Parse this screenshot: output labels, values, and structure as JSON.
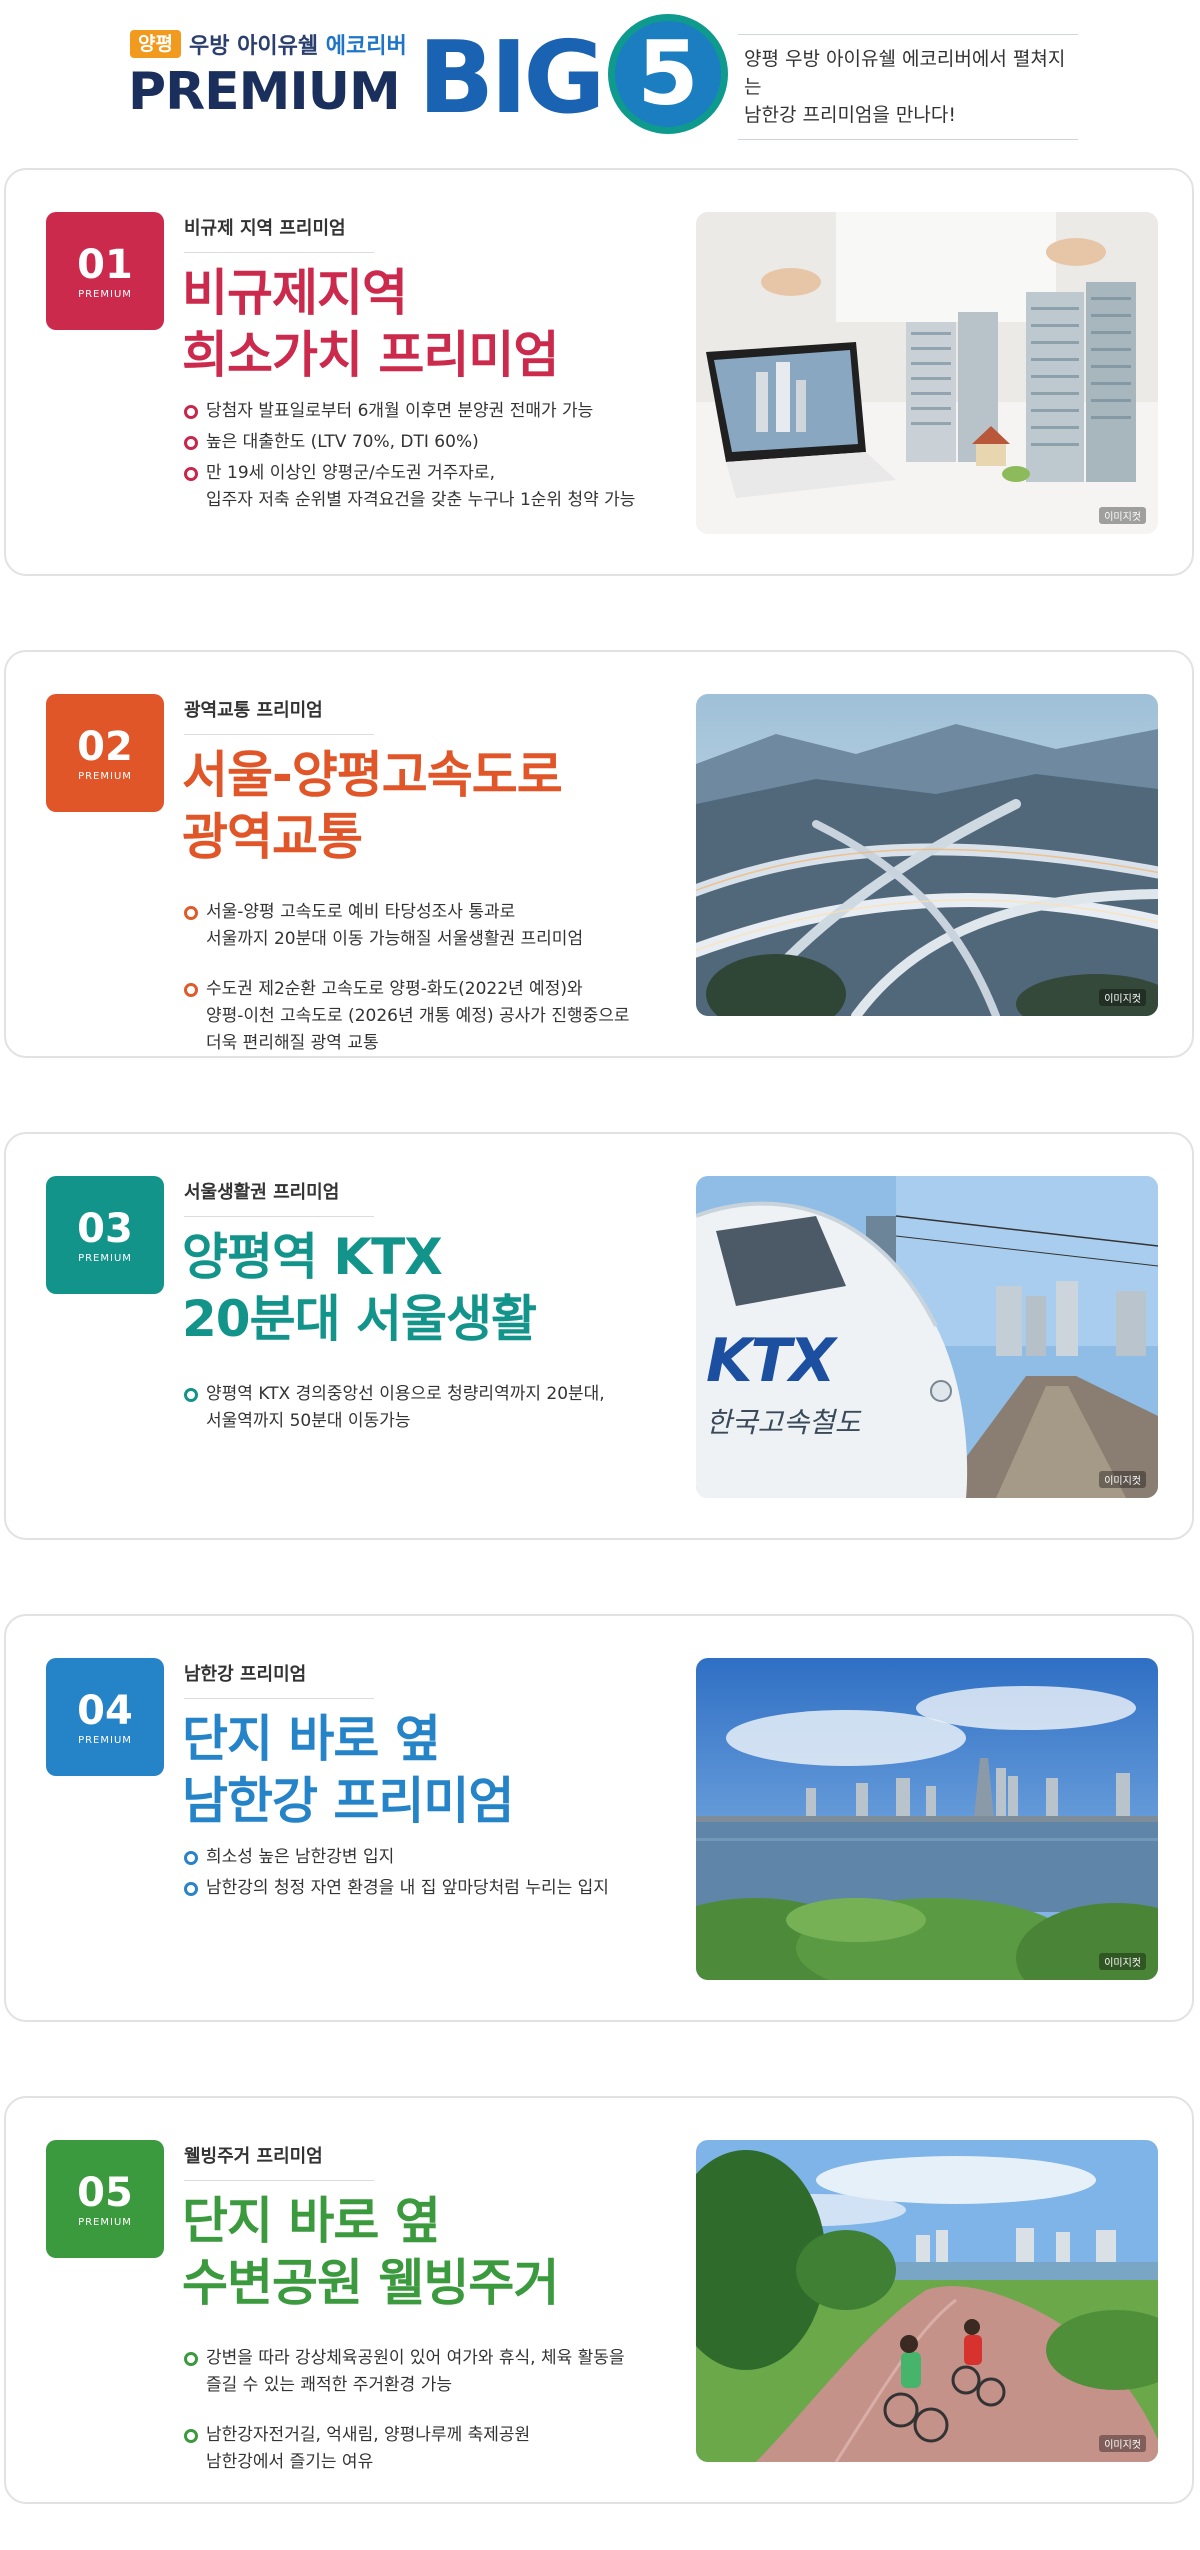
{
  "header": {
    "badge": "양평",
    "sub_left": "우방 아이유쉘",
    "sub_accent": "에코리버",
    "premium": "PREMIUM",
    "big": "BIG",
    "five": "5",
    "desc_line1": "양평 우방 아이유쉘 에코리버에서 펼쳐지는",
    "desc_line2": "남한강 프리미엄을 만나다!"
  },
  "colors": {
    "card1": "#cc2a4d",
    "card2": "#e15628",
    "card3": "#13948b",
    "card4": "#2583c8",
    "card5": "#3b9a3d"
  },
  "cards": [
    {
      "number": "01",
      "premium_label": "PREMIUM",
      "tag": "비규제 지역 프리미엄",
      "title_line1": "비규제지역",
      "title_line2": "희소가치 프리미엄",
      "bullets": [
        "당첨자 발표일로부터 6개월 이후면 분양권 전매가 가능",
        "높은 대출한도 (LTV 70%, DTI 60%)",
        "만 19세 이상인 양평군/수도권 거주자로,\n입주자 저축 순위별 자격요건을 갖춘 누구나 1순위 청약 가능"
      ],
      "image_note": "이미지컷"
    },
    {
      "number": "02",
      "premium_label": "PREMIUM",
      "tag": "광역교통 프리미엄",
      "title_line1": "서울-양평고속도로",
      "title_line2": "광역교통",
      "bullets": [
        "서울-양평 고속도로 예비 타당성조사 통과로\n서울까지 20분대 이동 가능해질 서울생활권 프리미엄",
        "수도권 제2순환 고속도로 양평-화도(2022년 예정)와\n양평-이천 고속도로 (2026년 개통 예정) 공사가 진행중으로\n더욱 편리해질 광역 교통"
      ],
      "image_note": "이미지컷"
    },
    {
      "number": "03",
      "premium_label": "PREMIUM",
      "tag": "서울생활권 프리미엄",
      "title_line1": "양평역 KTX",
      "title_line2": "20분대 서울생활",
      "bullets": [
        "양평역 KTX 경의중앙선 이용으로 청량리역까지 20분대,\n서울역까지 50분대 이동가능"
      ],
      "image_note": "이미지컷",
      "image_text_logo": "KTX",
      "image_text_sub": "한국고속철도"
    },
    {
      "number": "04",
      "premium_label": "PREMIUM",
      "tag": "남한강 프리미엄",
      "title_line1": "단지 바로 옆",
      "title_line2": "남한강 프리미엄",
      "bullets": [
        "희소성 높은 남한강변 입지",
        "남한강의 청정 자연 환경을 내 집 앞마당처럼 누리는 입지"
      ],
      "image_note": "이미지컷"
    },
    {
      "number": "05",
      "premium_label": "PREMIUM",
      "tag": "웰빙주거 프리미엄",
      "title_line1": "단지 바로 옆",
      "title_line2": "수변공원 웰빙주거",
      "bullets": [
        "강변을 따라 강상체육공원이 있어 여가와 휴식, 체육 활동을\n즐길 수 있는 쾌적한 주거환경 가능",
        "남한강자전거길, 억새림, 양평나루께 축제공원\n남한강에서 즐기는 여유"
      ],
      "image_note": "이미지컷"
    }
  ]
}
